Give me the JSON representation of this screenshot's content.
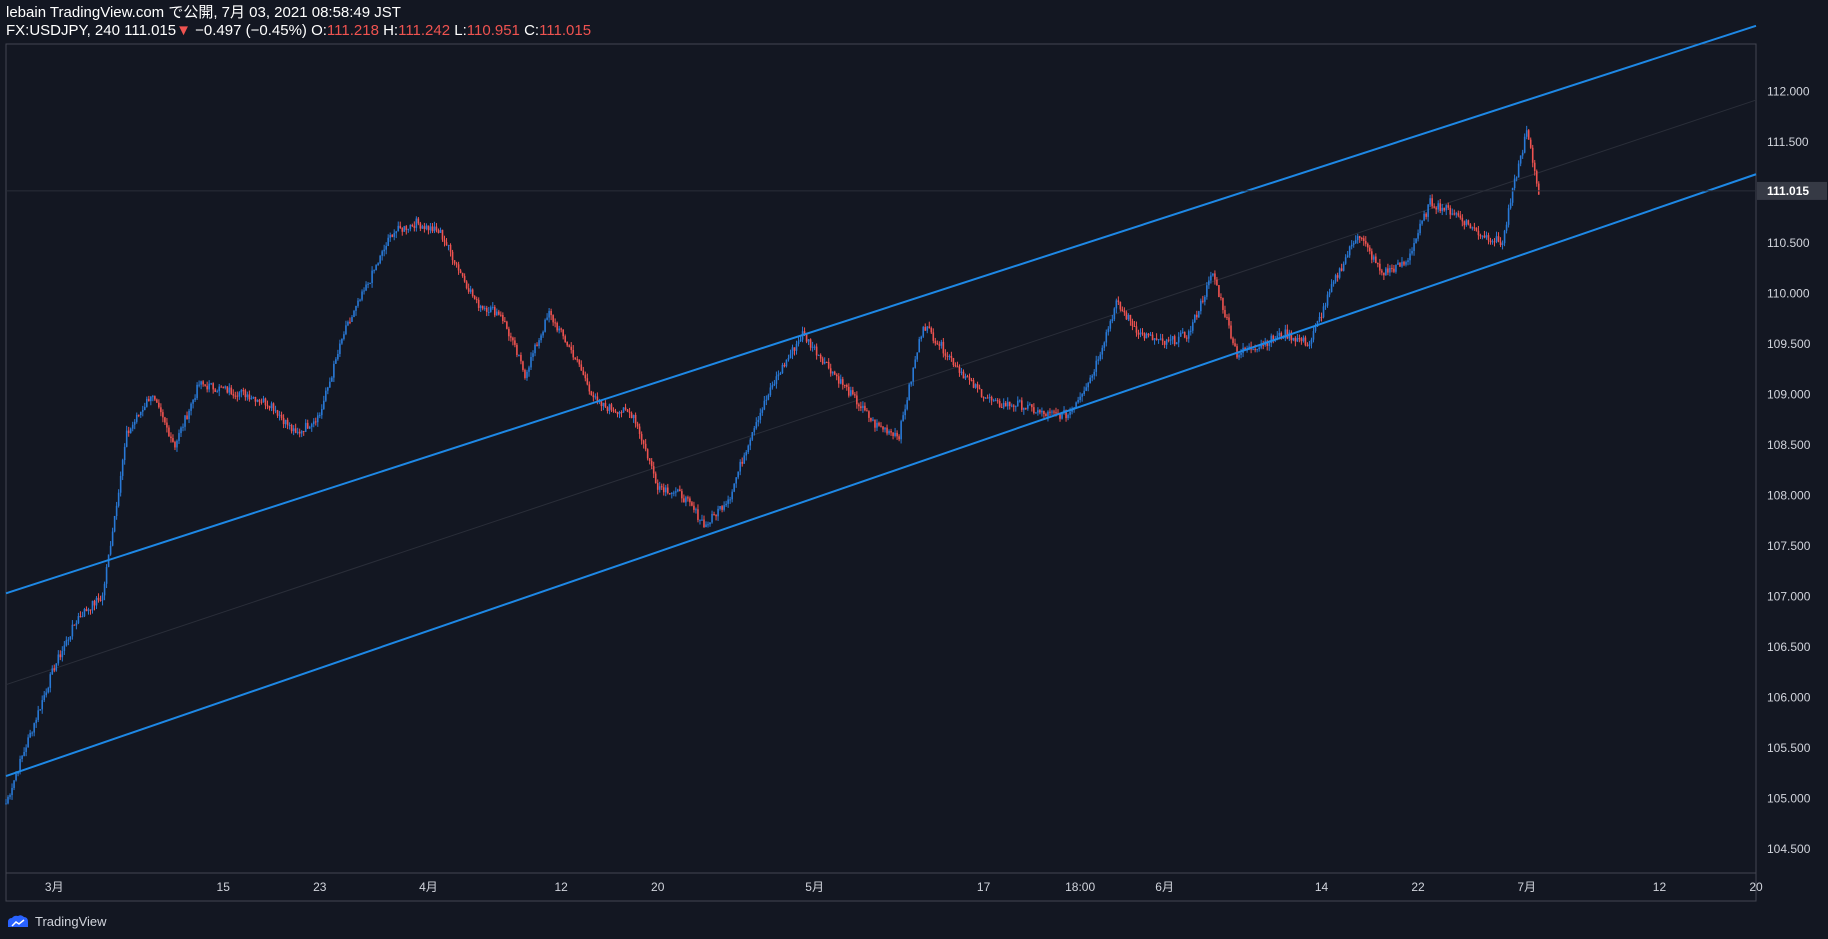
{
  "header": {
    "published": "lebain TradingView.com で公開, 7月 03, 2021 08:58:49 JST",
    "symbol": "FX:USDJPY, 240",
    "last": "111.015",
    "change": "−0.497 (−0.45%)",
    "o_label": "O:",
    "o_value": "111.218",
    "h_label": "H:",
    "h_value": "111.242",
    "l_label": "L:",
    "l_value": "110.951",
    "c_label": "C:",
    "c_value": "111.015"
  },
  "footer": {
    "brand": "TradingView"
  },
  "colors": {
    "background": "#131722",
    "up": "#2962ff",
    "up_candle": "#2979d6",
    "down": "#ef5350",
    "channel": "#1e88e5",
    "axis_text": "#d1d4dc",
    "price_tag": "#363a45"
  },
  "chart_data": {
    "type": "candlestick",
    "symbol": "FX:USDJPY",
    "interval": "240",
    "y_axis": {
      "ticks": [
        104.5,
        105.0,
        105.5,
        106.0,
        106.5,
        107.0,
        107.5,
        108.0,
        108.5,
        109.0,
        109.5,
        110.0,
        110.5,
        111.0,
        111.5,
        112.0
      ],
      "tick_labels": [
        "104.500",
        "105.000",
        "105.500",
        "106.000",
        "106.500",
        "107.000",
        "107.500",
        "108.000",
        "108.500",
        "109.000",
        "109.500",
        "110.000",
        "110.500",
        "111.000",
        "111.500",
        "112.000"
      ],
      "range": [
        104.26,
        112.47
      ]
    },
    "x_axis": {
      "labels": [
        "3月",
        "15",
        "23",
        "4月",
        "12",
        "20",
        "5月",
        "17",
        "18:00",
        "6月",
        "14",
        "22",
        "7月",
        "12",
        "20"
      ]
    },
    "last_price_label": "111.015",
    "close_path": [
      {
        "d": "2021-02-25",
        "c": 104.95
      },
      {
        "d": "2021-02-26",
        "c": 105.3
      },
      {
        "d": "2021-03-01",
        "c": 106.3
      },
      {
        "d": "2021-03-03",
        "c": 106.8
      },
      {
        "d": "2021-03-05",
        "c": 107.0
      },
      {
        "d": "2021-03-07",
        "c": 108.6
      },
      {
        "d": "2021-03-09",
        "c": 109.0
      },
      {
        "d": "2021-03-11",
        "c": 108.5
      },
      {
        "d": "2021-03-13",
        "c": 109.1
      },
      {
        "d": "2021-03-17",
        "c": 109.0
      },
      {
        "d": "2021-03-19",
        "c": 108.9
      },
      {
        "d": "2021-03-21",
        "c": 108.6
      },
      {
        "d": "2021-03-23",
        "c": 108.8
      },
      {
        "d": "2021-03-25",
        "c": 109.6
      },
      {
        "d": "2021-03-29",
        "c": 110.6
      },
      {
        "d": "2021-03-31",
        "c": 110.7
      },
      {
        "d": "2021-04-02",
        "c": 110.6
      },
      {
        "d": "2021-04-05",
        "c": 109.9
      },
      {
        "d": "2021-04-07",
        "c": 109.8
      },
      {
        "d": "2021-04-09",
        "c": 109.2
      },
      {
        "d": "2021-04-11",
        "c": 109.8
      },
      {
        "d": "2021-04-13",
        "c": 109.4
      },
      {
        "d": "2021-04-15",
        "c": 108.9
      },
      {
        "d": "2021-04-18",
        "c": 108.8
      },
      {
        "d": "2021-04-20",
        "c": 108.1
      },
      {
        "d": "2021-04-22",
        "c": 108.0
      },
      {
        "d": "2021-04-24",
        "c": 107.7
      },
      {
        "d": "2021-04-26",
        "c": 108.0
      },
      {
        "d": "2021-04-28",
        "c": 108.7
      },
      {
        "d": "2021-04-30",
        "c": 109.2
      },
      {
        "d": "2021-05-02",
        "c": 109.6
      },
      {
        "d": "2021-05-04",
        "c": 109.3
      },
      {
        "d": "2021-05-06",
        "c": 109.0
      },
      {
        "d": "2021-05-08",
        "c": 108.7
      },
      {
        "d": "2021-05-10",
        "c": 108.6
      },
      {
        "d": "2021-05-12",
        "c": 109.7
      },
      {
        "d": "2021-05-14",
        "c": 109.4
      },
      {
        "d": "2021-05-16",
        "c": 109.1
      },
      {
        "d": "2021-05-18",
        "c": 108.9
      },
      {
        "d": "2021-05-20",
        "c": 108.9
      },
      {
        "d": "2021-05-22",
        "c": 108.8
      },
      {
        "d": "2021-05-24",
        "c": 108.8
      },
      {
        "d": "2021-05-26",
        "c": 109.2
      },
      {
        "d": "2021-05-28",
        "c": 109.9
      },
      {
        "d": "2021-05-30",
        "c": 109.6
      },
      {
        "d": "2021-06-01",
        "c": 109.5
      },
      {
        "d": "2021-06-03",
        "c": 109.6
      },
      {
        "d": "2021-06-05",
        "c": 110.2
      },
      {
        "d": "2021-06-07",
        "c": 109.4
      },
      {
        "d": "2021-06-09",
        "c": 109.5
      },
      {
        "d": "2021-06-11",
        "c": 109.6
      },
      {
        "d": "2021-06-13",
        "c": 109.5
      },
      {
        "d": "2021-06-15",
        "c": 110.1
      },
      {
        "d": "2021-06-17",
        "c": 110.6
      },
      {
        "d": "2021-06-19",
        "c": 110.2
      },
      {
        "d": "2021-06-21",
        "c": 110.3
      },
      {
        "d": "2021-06-23",
        "c": 110.9
      },
      {
        "d": "2021-06-25",
        "c": 110.8
      },
      {
        "d": "2021-06-27",
        "c": 110.6
      },
      {
        "d": "2021-06-29",
        "c": 110.5
      },
      {
        "d": "2021-06-30",
        "c": 111.1
      },
      {
        "d": "2021-07-01",
        "c": 111.6
      },
      {
        "d": "2021-07-02",
        "c": 111.015
      }
    ],
    "channel_lines": [
      {
        "name": "upper",
        "from": {
          "d": "2021-02-25",
          "price": 107.03
        },
        "to": {
          "d": "2021-07-20",
          "price": 112.65
        }
      },
      {
        "name": "lower",
        "from": {
          "d": "2021-02-25",
          "price": 105.22
        },
        "to": {
          "d": "2021-07-20",
          "price": 111.18
        }
      }
    ],
    "grid": false,
    "legend": "none"
  }
}
